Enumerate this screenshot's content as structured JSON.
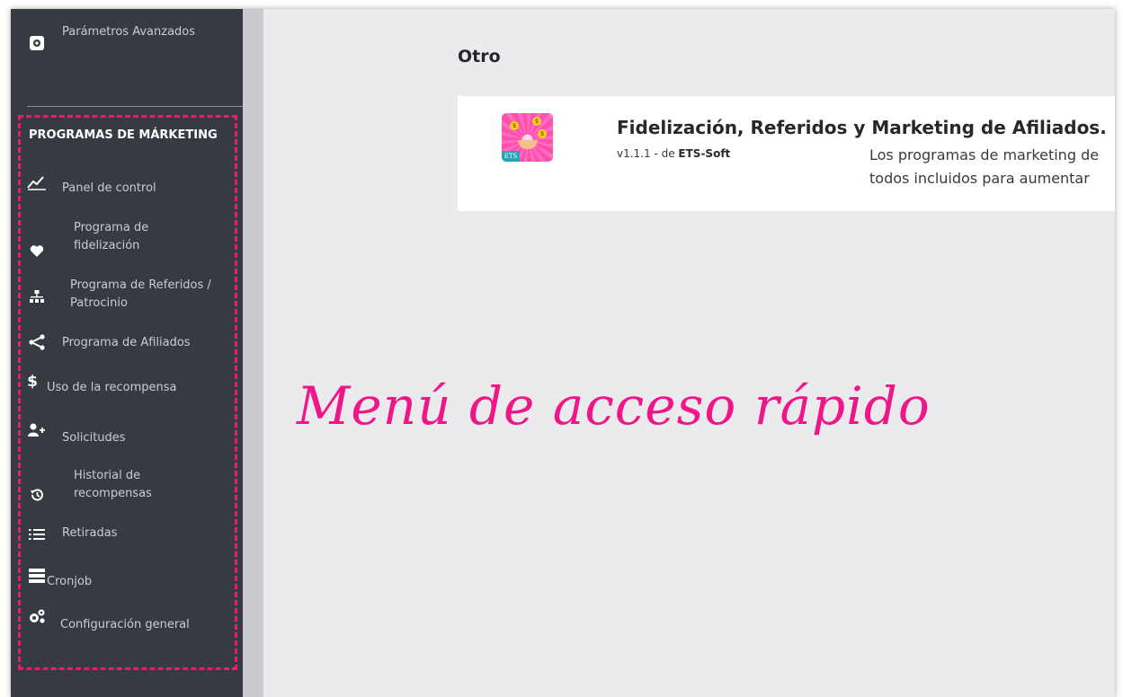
{
  "sidebar": {
    "top_item": {
      "label": "Parámetros Avanzados",
      "icon": "gear-icon"
    },
    "section_title": "PROGRAMAS DE MÁRKETING",
    "items": [
      {
        "label": "Panel de control",
        "icon": "chart-line-icon"
      },
      {
        "label": "Programa de fidelización",
        "icon": "heart-icon"
      },
      {
        "label": "Programa de Referidos / Patrocinio",
        "icon": "sitemap-icon"
      },
      {
        "label": "Programa de Afiliados",
        "icon": "share-icon"
      },
      {
        "label": "Uso de la recompensa",
        "icon": "dollar-icon"
      },
      {
        "label": "Solicitudes",
        "icon": "user-plus-icon"
      },
      {
        "label": "Historial de recompensas",
        "icon": "history-icon"
      },
      {
        "label": "Retiradas",
        "icon": "list-icon"
      },
      {
        "label": "Cronjob",
        "icon": "server-icon"
      },
      {
        "label": "Configuración general",
        "icon": "cogs-icon"
      }
    ],
    "highlight_color": "#f0186f"
  },
  "content": {
    "section_heading": "Otro",
    "module": {
      "title": "Fidelización, Referidos y Marketing de Afiliados.",
      "version": "v1.1.1 - de",
      "author": "ETS-Soft",
      "description_line1": "Los programas de marketing de",
      "description_line2": "todos incluidos para aumentar",
      "badge": "ETS"
    }
  },
  "overlay_caption": {
    "text": "Menú de acceso rápido",
    "color": "#f0168a"
  }
}
